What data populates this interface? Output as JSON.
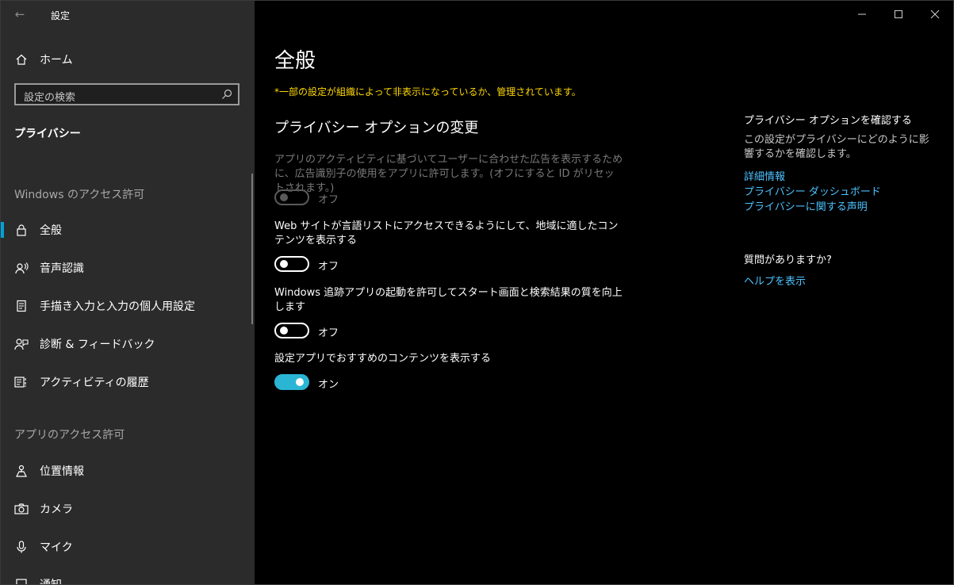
{
  "window": {
    "title": "設定"
  },
  "sidebar": {
    "home_label": "ホーム",
    "search_placeholder": "設定の検索",
    "current_section": "プライバシー",
    "group_windows": "Windows のアクセス許可",
    "windows_items": [
      {
        "label": "全般",
        "icon": "lock-icon"
      },
      {
        "label": "音声認識",
        "icon": "speech-icon"
      },
      {
        "label": "手描き入力と入力の個人用設定",
        "icon": "inking-icon"
      },
      {
        "label": "診断 & フィードバック",
        "icon": "feedback-icon"
      },
      {
        "label": "アクティビティの履歴",
        "icon": "activity-icon"
      }
    ],
    "group_apps": "アプリのアクセス許可",
    "app_items": [
      {
        "label": "位置情報",
        "icon": "location-icon"
      },
      {
        "label": "カメラ",
        "icon": "camera-icon"
      },
      {
        "label": "マイク",
        "icon": "microphone-icon"
      },
      {
        "label": "通知",
        "icon": "notification-icon"
      }
    ]
  },
  "main": {
    "title": "全般",
    "managed_note": "*一部の設定が組織によって非表示になっているか、管理されています。",
    "subheading": "プライバシー オプションの変更",
    "settings": [
      {
        "desc": "アプリのアクティビティに基づいてユーザーに合わせた広告を表示するために、広告識別子の使用をアプリに許可します。(オフにすると ID がリセットされます。)",
        "state": "オフ",
        "on": false,
        "disabled": true
      },
      {
        "desc": "Web サイトが言語リストにアクセスできるようにして、地域に適したコンテンツを表示する",
        "state": "オフ",
        "on": false,
        "disabled": false
      },
      {
        "desc": "Windows 追跡アプリの起動を許可してスタート画面と検索結果の質を向上します",
        "state": "オフ",
        "on": false,
        "disabled": false
      },
      {
        "desc": "設定アプリでおすすめのコンテンツを表示する",
        "state": "オン",
        "on": true,
        "disabled": false
      }
    ]
  },
  "aside": {
    "review_title": "プライバシー オプションを確認する",
    "review_text": "この設定がプライバシーにどのように影響するかを確認します。",
    "links": [
      "詳細情報",
      "プライバシー ダッシュボード",
      "プライバシーに関する声明"
    ],
    "question_title": "質問がありますか?",
    "help_link": "ヘルプを表示"
  },
  "colors": {
    "accent": "#2bb5d4",
    "link": "#4cc2ff",
    "warning": "#ffd800",
    "sidebar_bg": "#2b2b2b"
  }
}
